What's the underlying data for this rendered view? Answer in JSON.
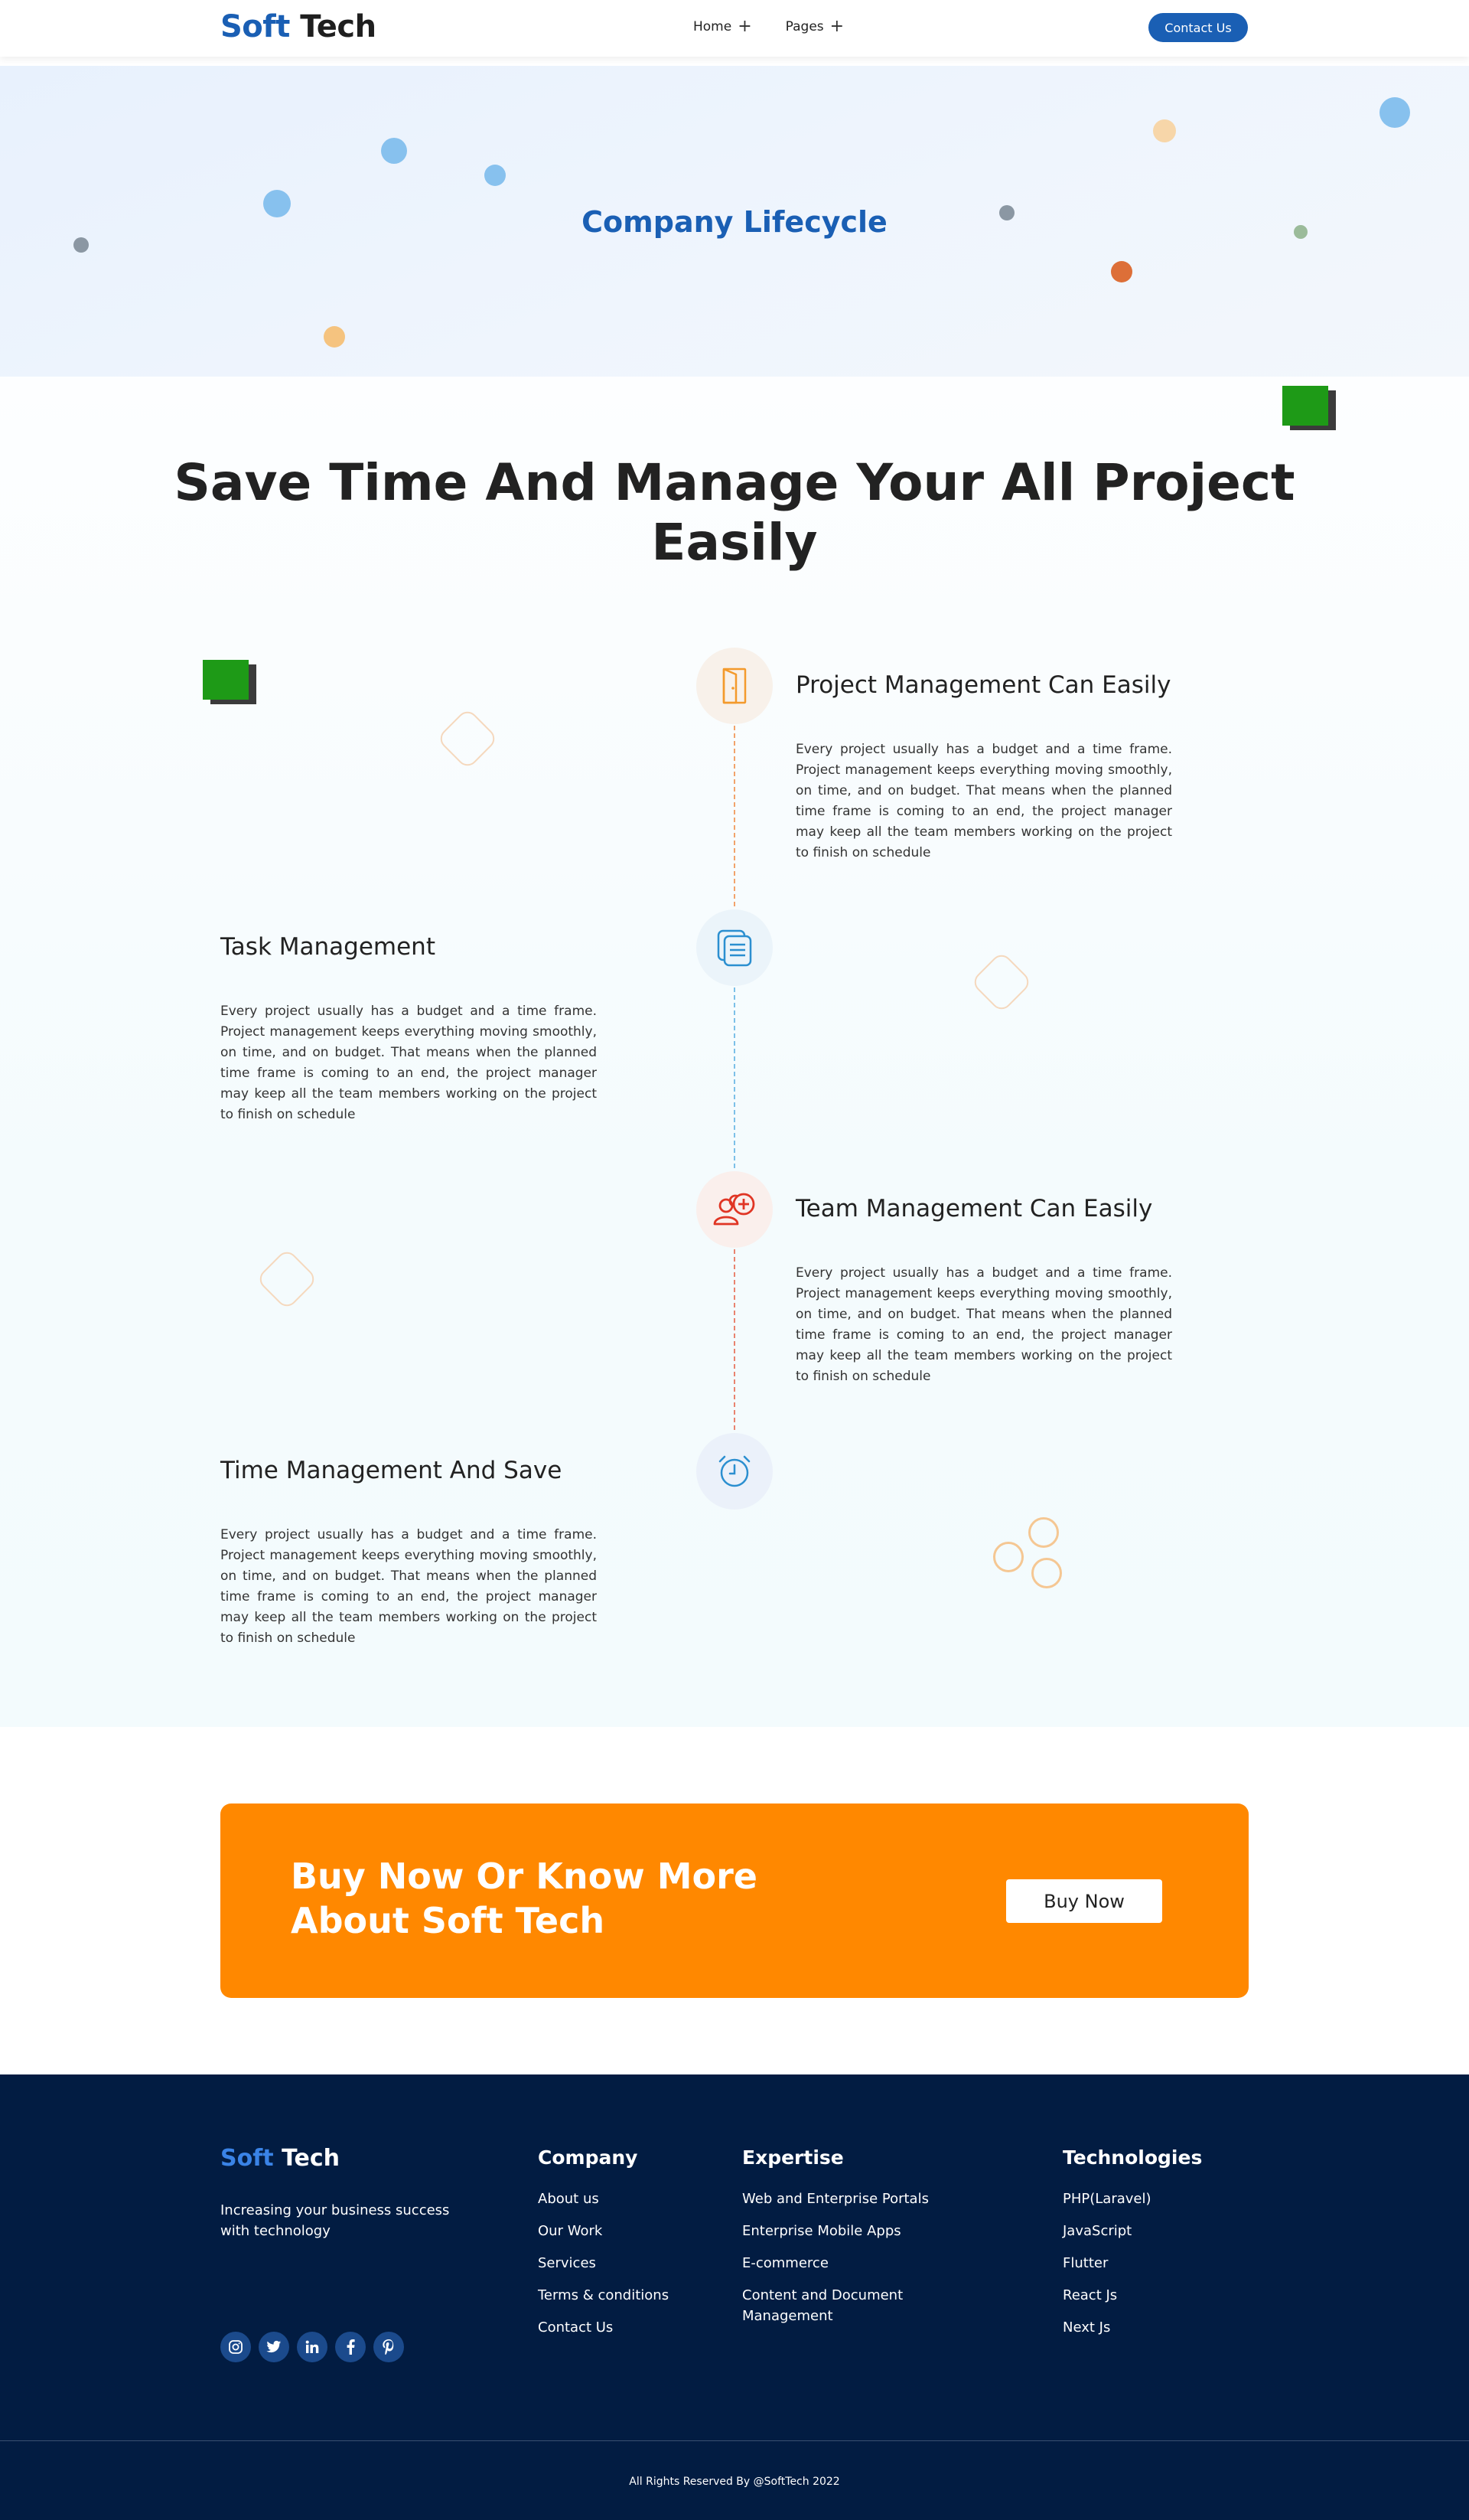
{
  "nav": {
    "logo_part1": "Soft",
    "logo_part2": "Tech",
    "links": [
      {
        "label": "Home"
      },
      {
        "label": "Pages"
      }
    ],
    "contact_label": "Contact Us",
    "brand_color": "#1a5fb4"
  },
  "hero": {
    "title": "Company Lifecycle"
  },
  "main": {
    "headline_line1": "Save Time And Manage Your All Project",
    "headline_line2": "Easily",
    "steps": [
      {
        "title": "Project Management Can Easily",
        "text": "Every project usually has a budget and a time frame. Project management keeps everything moving smoothly, on time, and on budget. That means when the planned time frame is coming to an end, the project manager may keep all the team members working on the project to finish on schedule",
        "icon": "door-icon"
      },
      {
        "title": "Task Management",
        "text": "Every project usually has a budget and a time frame. Project management keeps everything moving smoothly, on time, and on budget. That means when the planned time frame is coming to an end, the project manager may keep all the team members working on the project to finish on schedule",
        "icon": "document-list-icon"
      },
      {
        "title": "Team Management Can Easily",
        "text": "Every project usually has a budget and a time frame. Project management keeps everything moving smoothly, on time, and on budget. That means when the planned time frame is coming to an end, the project manager may keep all the team members working on the project to finish on schedule",
        "icon": "add-team-icon"
      },
      {
        "title": "Time Management And Save",
        "text": "Every project usually has a budget and a time frame. Project management keeps everything moving smoothly, on time, and on budget. That means when the planned time frame is coming to an end, the project manager may keep all the team members working on the project to finish on schedule",
        "icon": "alarm-clock-icon"
      }
    ]
  },
  "cta": {
    "title_line1": "Buy Now Or Know More",
    "title_line2": "About Soft Tech",
    "button_label": "Buy Now",
    "accent_color": "#ff8800"
  },
  "footer": {
    "logo_part1": "Soft",
    "logo_part2": "Tech",
    "tagline": "Increasing your business success with technology",
    "socials": [
      "instagram-icon",
      "twitter-icon",
      "linkedin-icon",
      "facebook-icon",
      "pinterest-icon"
    ],
    "columns": [
      {
        "title": "Company",
        "items": [
          "About us",
          "Our Work",
          "Services",
          "Terms & conditions",
          "Contact Us"
        ]
      },
      {
        "title": "Expertise",
        "items": [
          "Web and Enterprise Portals",
          "Enterprise Mobile Apps",
          "E-commerce",
          "Content and Document Management"
        ]
      },
      {
        "title": "Technologies",
        "items": [
          "PHP(Laravel)",
          "JavaScript",
          "Flutter",
          "React Js",
          "Next Js"
        ]
      }
    ],
    "copyright": "All Rights Reserved By @SoftTech 2022",
    "background_color": "#021c42"
  }
}
